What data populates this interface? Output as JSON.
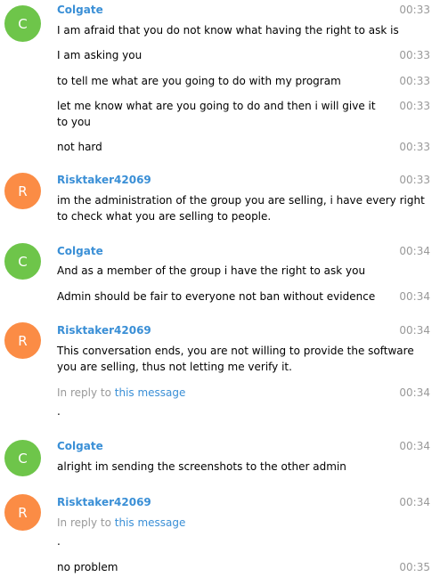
{
  "messages": [
    {
      "kind": "head",
      "user": "Colgate",
      "initial": "C",
      "time": "00:33",
      "text": "I am afraid that you do not know what having the right to ask is"
    },
    {
      "kind": "msg",
      "time": "00:33",
      "text": "I am asking you"
    },
    {
      "kind": "msg",
      "time": "00:33",
      "text": "to tell me what are you going to do with my program"
    },
    {
      "kind": "msg",
      "time": "00:33",
      "text": "let me know what are you going to do and then i will give it to you"
    },
    {
      "kind": "msg",
      "time": "00:33",
      "text": "not hard"
    },
    {
      "kind": "head",
      "user": "Risktaker42069",
      "initial": "R",
      "time": "00:33",
      "text": "im the administration of the group you are selling, i have every right to check what you are selling to people."
    },
    {
      "kind": "head",
      "user": "Colgate",
      "initial": "C",
      "time": "00:34",
      "text": "And as a member of the group i have the right to ask you"
    },
    {
      "kind": "msg",
      "time": "00:34",
      "text": "Admin should be fair to everyone not ban without evidence"
    },
    {
      "kind": "head",
      "user": "Risktaker42069",
      "initial": "R",
      "time": "00:34",
      "text": "This conversation ends, you are not willing to provide the software you are selling, thus not letting me verify it."
    },
    {
      "kind": "reply",
      "time": "00:34",
      "reply_prefix": "In reply to",
      "reply_link": "this message",
      "text": "."
    },
    {
      "kind": "head",
      "user": "Colgate",
      "initial": "C",
      "time": "00:34",
      "text": "alright im sending the screenshots to the other admin"
    },
    {
      "kind": "head-reply",
      "user": "Risktaker42069",
      "initial": "R",
      "time": "00:34",
      "reply_prefix": "In reply to",
      "reply_link": "this message",
      "text": "."
    },
    {
      "kind": "msg",
      "time": "00:35",
      "text": "no problem"
    }
  ],
  "colors": {
    "colgate_avatar": "#6ec54a",
    "risktaker_avatar": "#fb8c45",
    "name": "#3a8fd6",
    "time": "#999999"
  }
}
